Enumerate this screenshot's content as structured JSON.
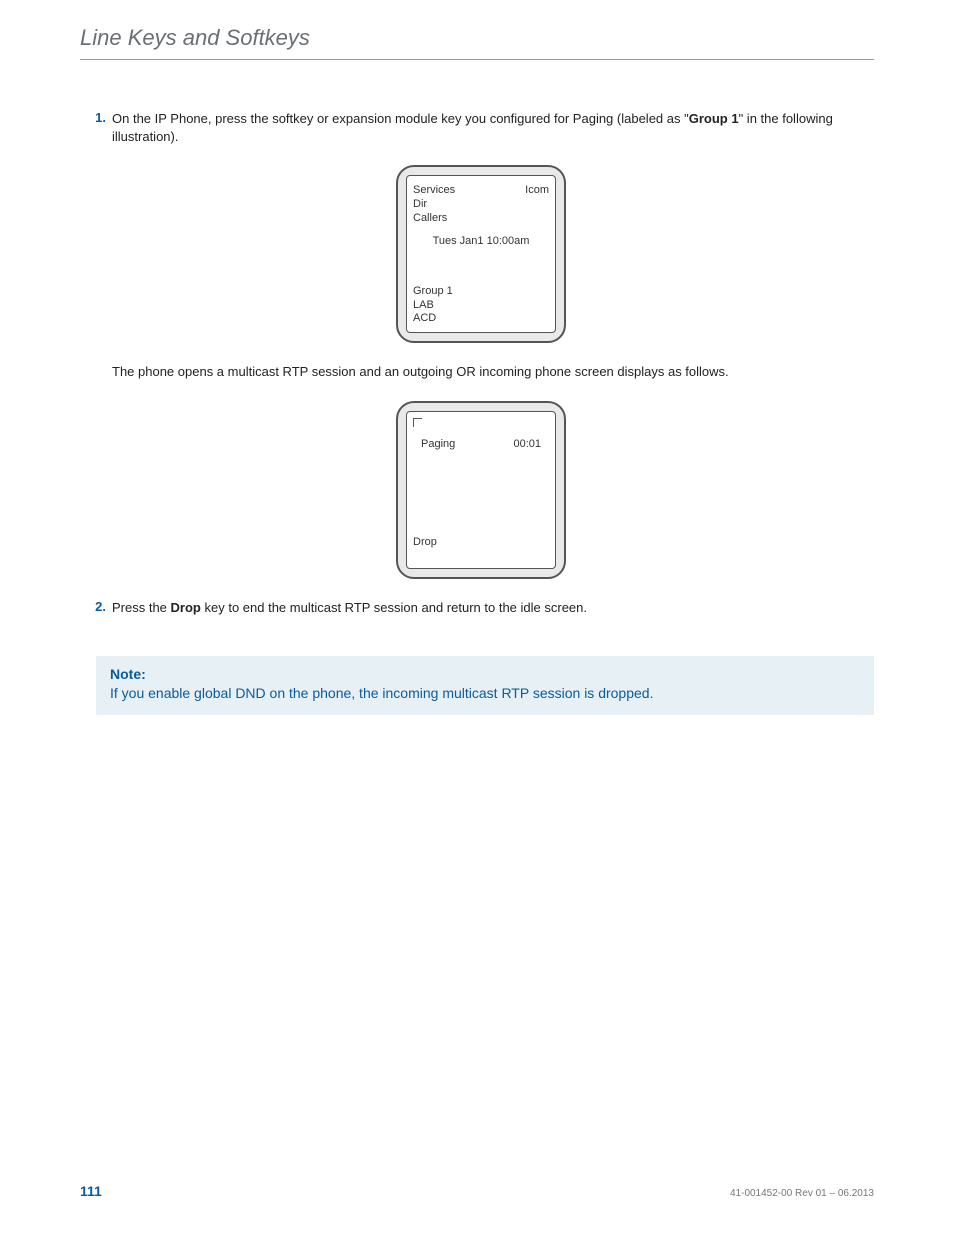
{
  "header": {
    "title": "Line Keys and Softkeys"
  },
  "step1": {
    "num": "1.",
    "text_a": "On the IP Phone, press the softkey or expansion module key you configured for Paging (labeled as \"",
    "bold": "Group 1",
    "text_b": "\" in the following illustration)."
  },
  "screen1": {
    "services": "Services",
    "icom": "Icom",
    "dir": "Dir",
    "callers": "Callers",
    "datetime": "Tues Jan1 10:00am",
    "group1": "Group 1",
    "lab": "LAB",
    "acd": "ACD"
  },
  "para1": "The phone opens a multicast RTP session and an outgoing OR incoming phone screen displays as follows.",
  "screen2": {
    "paging": "Paging",
    "timer": "00:01",
    "drop": "Drop"
  },
  "step2": {
    "num": "2.",
    "text_a": "Press the ",
    "bold": "Drop",
    "text_b": " key to end the multicast RTP session and return to the idle screen."
  },
  "note": {
    "heading": "Note:",
    "body": "If you enable global DND on the phone, the incoming multicast RTP session is dropped."
  },
  "footer": {
    "page": "111",
    "docid": "41-001452-00 Rev 01 – 06.2013"
  }
}
